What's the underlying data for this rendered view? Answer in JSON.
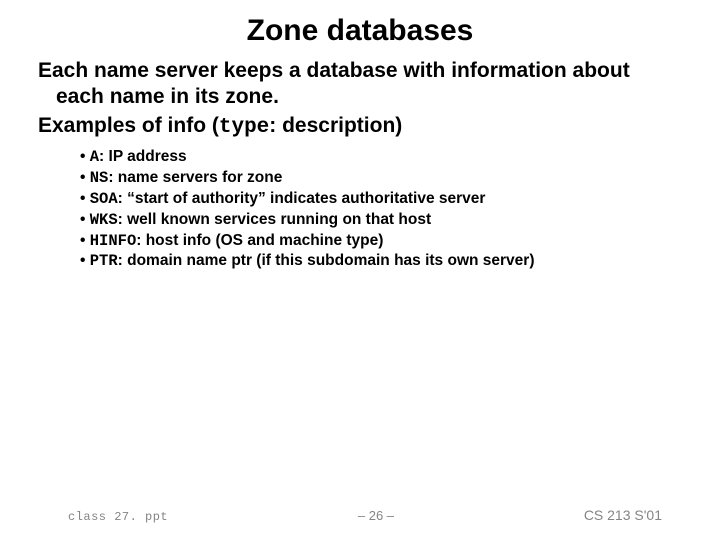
{
  "title": "Zone databases",
  "paragraph1": "Each name server keeps a database with information about each name in its zone.",
  "examples_prefix": "Examples of info (",
  "examples_type_word": "type",
  "examples_suffix": ": description)",
  "bullets": [
    {
      "code": "A",
      "text": ": IP address"
    },
    {
      "code": "NS",
      "text": ": name servers for zone"
    },
    {
      "code": "SOA",
      "text": ": “start of authority” indicates authoritative server"
    },
    {
      "code": "WKS",
      "text": ": well known services running on that host"
    },
    {
      "code": "HINFO",
      "text": ": host info (OS and machine type)"
    },
    {
      "code": "PTR",
      "text": ": domain name ptr (if this subdomain has its own server)"
    }
  ],
  "footer": {
    "file": "class 27. ppt",
    "page": "– 26 –",
    "course": "CS 213 S'01"
  }
}
